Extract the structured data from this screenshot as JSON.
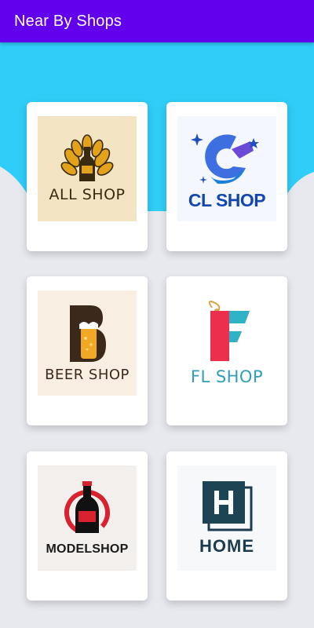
{
  "app_bar": {
    "title": "Near By Shops"
  },
  "colors": {
    "app_bar": "#6200ee",
    "hero": "#2fcdf7",
    "background": "#e7e9ef",
    "card": "#ffffff"
  },
  "shops": [
    {
      "name": "ALL SHOP",
      "logo_icon": "beer-bottle-wheat-icon"
    },
    {
      "name": "CL SHOP",
      "logo_icon": "cl-swirl-icon"
    },
    {
      "name": "BEER SHOP",
      "logo_icon": "beer-glass-b-icon"
    },
    {
      "name": "FL SHOP",
      "logo_icon": "price-tag-f-icon"
    },
    {
      "name": "MODELSHOP",
      "logo_icon": "bottle-ring-icon"
    },
    {
      "name": "HOME",
      "logo_icon": "h-square-icon"
    }
  ]
}
